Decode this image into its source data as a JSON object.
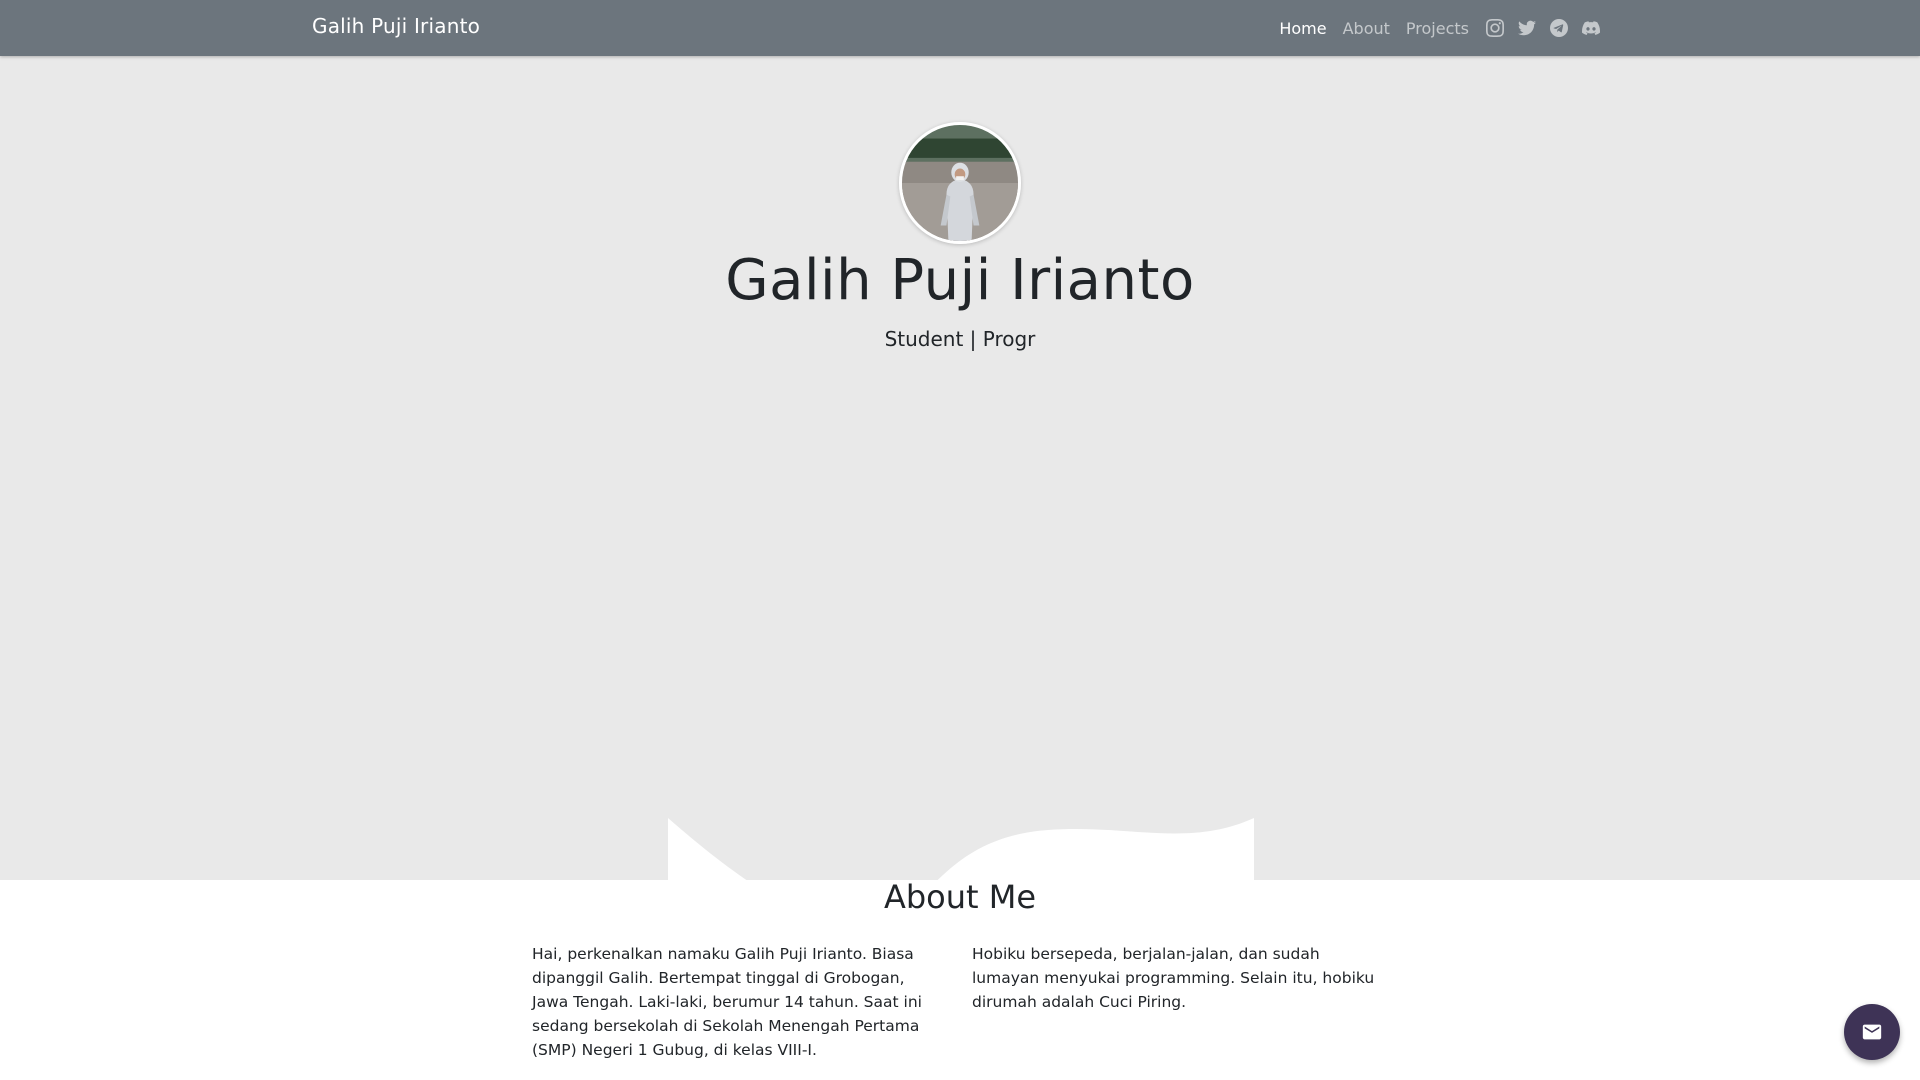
{
  "navbar": {
    "brand": "Galih Puji Irianto",
    "links": [
      {
        "label": "Home",
        "active": true
      },
      {
        "label": "About",
        "active": false
      },
      {
        "label": "Projects",
        "active": false
      }
    ],
    "icons": [
      "instagram-icon",
      "twitter-icon",
      "telegram-icon",
      "discord-icon"
    ]
  },
  "hero": {
    "avatar": "profile-photo",
    "name": "Galih Puji Irianto",
    "subtitle": "Student | Progr"
  },
  "about": {
    "title": "About Me",
    "left_paragraph": "Hai, perkenalkan namaku Galih Puji Irianto. Biasa dipanggil Galih. Bertempat tinggal di Grobogan, Jawa Tengah. Laki-laki, berumur 14 tahun. Saat ini sedang bersekolah di Sekolah Menengah Pertama (SMP) Negeri 1 Gubug, di kelas VIII-I.",
    "right_paragraph": "Hobiku bersepeda, berjalan-jalan, dan sudah lumayan menyukai programming. Selain itu, hobiku dirumah adalah Cuci Piring."
  },
  "fab": {
    "icon": "mail-icon"
  },
  "colors": {
    "navbar": "#6c757d",
    "hero_bg": "#e9e9e9",
    "fab": "#3e3356"
  }
}
